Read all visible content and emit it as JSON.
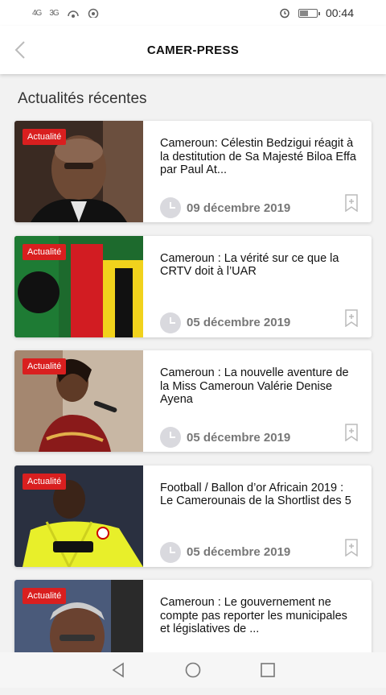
{
  "status": {
    "left_signal_1": "4G",
    "left_signal_2": "3G",
    "time": "00:44",
    "battery_level": 0.55
  },
  "appbar": {
    "title": "CAMER-PRESS"
  },
  "section": {
    "title": "Actualités récentes"
  },
  "articles": [
    {
      "badge": "Actualité",
      "title": "Cameroun: Célestin Bedzigui réagit à la destitution de Sa Majesté Biloa Effa par Paul At...",
      "date": "09 décembre 2019"
    },
    {
      "badge": "Actualité",
      "title": "Cameroun : La vérité sur ce que la CRTV doit à l’UAR",
      "date": "05 décembre 2019"
    },
    {
      "badge": "Actualité",
      "title": "Cameroun : La nouvelle aventure de la Miss Cameroun Valérie Denise Ayena",
      "date": "05 décembre 2019"
    },
    {
      "badge": "Actualité",
      "title": "Football / Ballon d’or Africain 2019 : Le Camerounais de la Shortlist des 5",
      "date": "05 décembre 2019"
    },
    {
      "badge": "Actualité",
      "title": "Cameroun : Le gouvernement ne compte pas reporter les municipales et législatives de ...",
      "date": ""
    }
  ],
  "icons": {
    "back": "chevron-left-icon",
    "clock": "clock-icon",
    "bookmark": "bookmark-add-icon",
    "nav_back": "triangle-back-icon",
    "nav_home": "circle-home-icon",
    "nav_recent": "square-recent-icon"
  },
  "colors": {
    "badge": "#d91f1f",
    "date": "#777777"
  }
}
